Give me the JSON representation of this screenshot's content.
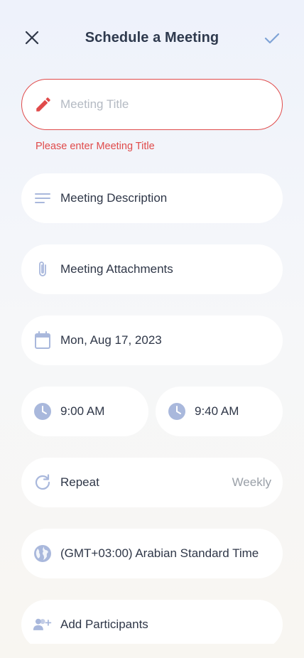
{
  "header": {
    "title": "Schedule a Meeting",
    "close_icon": "close-icon",
    "confirm_icon": "check-icon"
  },
  "form": {
    "title_field": {
      "value": "",
      "placeholder": "Meeting Title",
      "icon": "pencil-icon",
      "error": "Please enter Meeting Title"
    },
    "description": {
      "label": "Meeting Description",
      "icon": "description-icon"
    },
    "attachments": {
      "label": "Meeting Attachments",
      "icon": "paperclip-icon"
    },
    "date": {
      "label": "Mon, Aug 17, 2023",
      "icon": "calendar-icon"
    },
    "start_time": {
      "label": "9:00 AM",
      "icon": "clock-icon"
    },
    "end_time": {
      "label": "9:40 AM",
      "icon": "clock-icon"
    },
    "repeat": {
      "label": "Repeat",
      "value": "Weekly",
      "icon": "repeat-icon"
    },
    "timezone": {
      "label": "(GMT+03:00) Arabian Standard Time",
      "icon": "globe-icon"
    },
    "participants": {
      "label": "Add Participants",
      "icon": "add-participants-icon"
    }
  },
  "colors": {
    "error": "#e04a4a",
    "icon_muted": "#a9b8dc",
    "confirm": "#7fa3d6",
    "text": "#2f3748",
    "placeholder": "#b4bac3",
    "secondary_text": "#9aa0a8"
  }
}
